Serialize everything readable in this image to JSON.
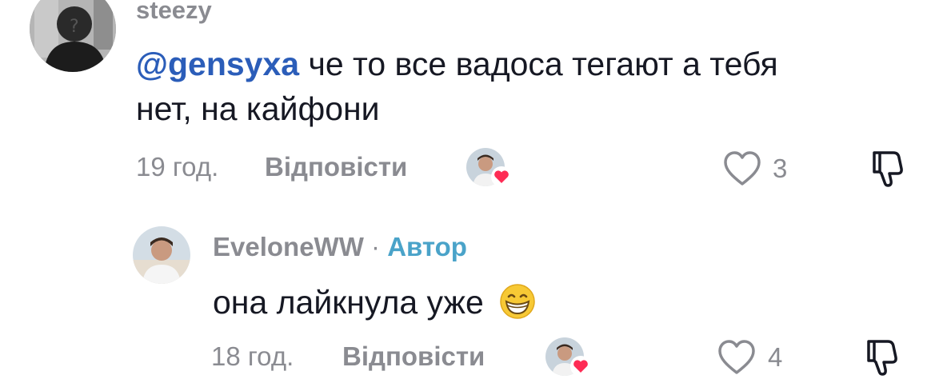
{
  "comments": [
    {
      "username": "steezy",
      "mention": "@gensyxa",
      "text_line1": " че то все вадоса тегают а тебя",
      "text_line2": "нет, на кайфони",
      "time": "19 год.",
      "reply_label": "Відповісти",
      "likes": "3"
    },
    {
      "username": "EveloneWW",
      "separator": "·",
      "author_label": "Автор",
      "text": "она лайкнула уже",
      "emoji": "grinning-face-with-smiling-eyes",
      "time": "18 год.",
      "reply_label": "Відповісти",
      "likes": "4"
    }
  ],
  "colors": {
    "text": "#161823",
    "secondary": "#8a8b91",
    "mention": "#2b5db9",
    "author": "#4aa3c9",
    "liked_badge": "#fe2c55"
  }
}
